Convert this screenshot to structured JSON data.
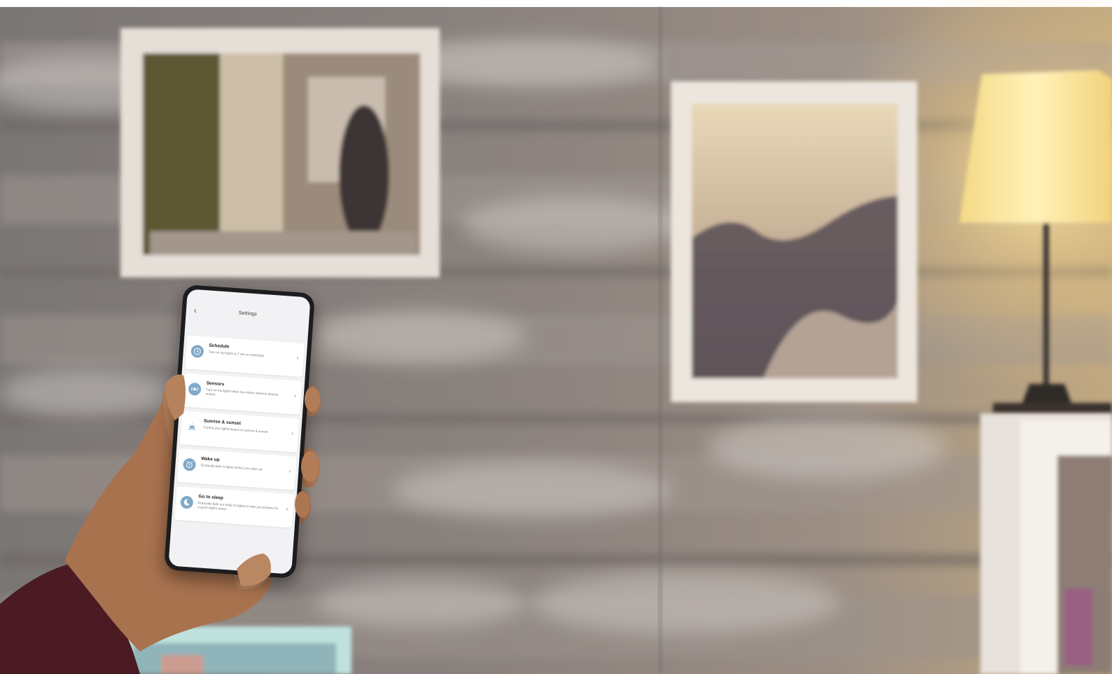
{
  "app": {
    "title": "Settings",
    "back_label": "‹",
    "chevron": "›"
  },
  "settings_items": [
    {
      "title": "Schedule",
      "description": "Turn on my lights at 7 am on weekdays",
      "icon": "clock-icon"
    },
    {
      "title": "Sensors",
      "description": "Turn on my lights when my motion detector detects motion",
      "icon": "sensor-icon"
    },
    {
      "title": "Sunrise & sunset",
      "description": "Control your lights based on sunrise & sunset",
      "icon": "sunrise-icon"
    },
    {
      "title": "Wake up",
      "description": "Gradually fade in lights before you wake up",
      "icon": "alarm-clock-icon"
    },
    {
      "title": "Go to sleep",
      "description": "Gradually fade out lowly on lights to help you prepare for a good night's sleep",
      "icon": "moon-icon"
    }
  ],
  "colors": {
    "icon_accent": "#7fa9c8",
    "lamp_glow": "#f7df8e",
    "wall": "#8a817b"
  }
}
